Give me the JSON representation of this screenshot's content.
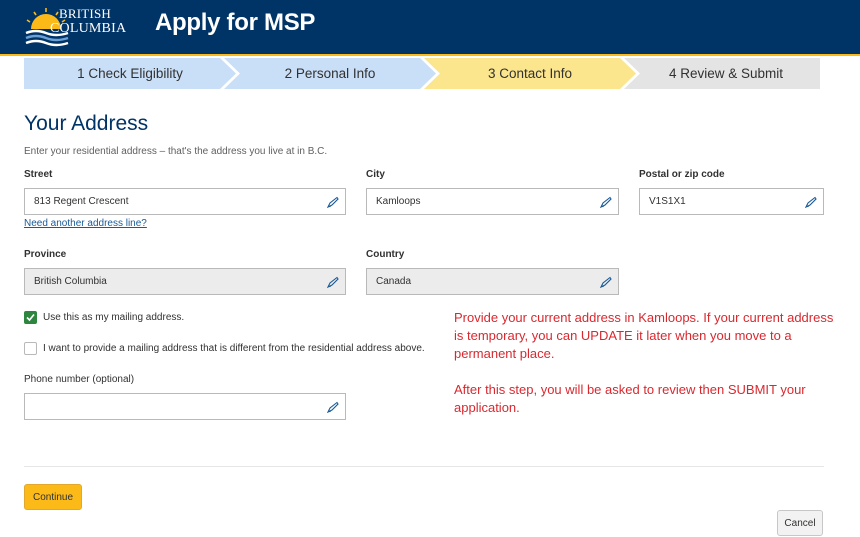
{
  "header": {
    "logo_line1": "BRITISH",
    "logo_line2": "COLUMBIA",
    "title": "Apply for MSP"
  },
  "steps": [
    {
      "label": "1 Check Eligibility",
      "state": "complete"
    },
    {
      "label": "2 Personal Info",
      "state": "complete"
    },
    {
      "label": "3 Contact Info",
      "state": "current"
    },
    {
      "label": "4 Review & Submit",
      "state": "upcoming"
    }
  ],
  "colors": {
    "header_bg": "#003366",
    "accent_gold": "#fcba19",
    "step_complete": "#c9def7",
    "step_current": "#fbe58d",
    "step_upcoming": "#e4e4e4",
    "note_red": "#d8292f"
  },
  "form": {
    "title": "Your Address",
    "intro": "Enter your residential address – that's the address you live at in B.C.",
    "street": {
      "label": "Street",
      "value": "813 Regent Crescent"
    },
    "city": {
      "label": "City",
      "value": "Kamloops"
    },
    "postal": {
      "label": "Postal or zip code",
      "value": "V1S1X1"
    },
    "another_line_link": "Need another address line?",
    "province": {
      "label": "Province",
      "value": "British Columbia"
    },
    "country": {
      "label": "Country",
      "value": "Canada"
    },
    "mailing_same": {
      "label": "Use this as my mailing address.",
      "checked": true
    },
    "mailing_different": {
      "label": "I want to provide a mailing address that is different from the residential address above.",
      "checked": false
    },
    "phone": {
      "label": "Phone number (optional)",
      "value": ""
    }
  },
  "notes": {
    "para1": "Provide your current address in Kamloops. If your current address is temporary, you can UPDATE it later when you move to a permanent place.",
    "para2": "After this step, you will be asked to review then SUBMIT your application."
  },
  "buttons": {
    "continue": "Continue",
    "cancel": "Cancel"
  },
  "icons": {
    "field_edit": "pencil-icon",
    "checkbox_check": "checkmark-icon"
  }
}
